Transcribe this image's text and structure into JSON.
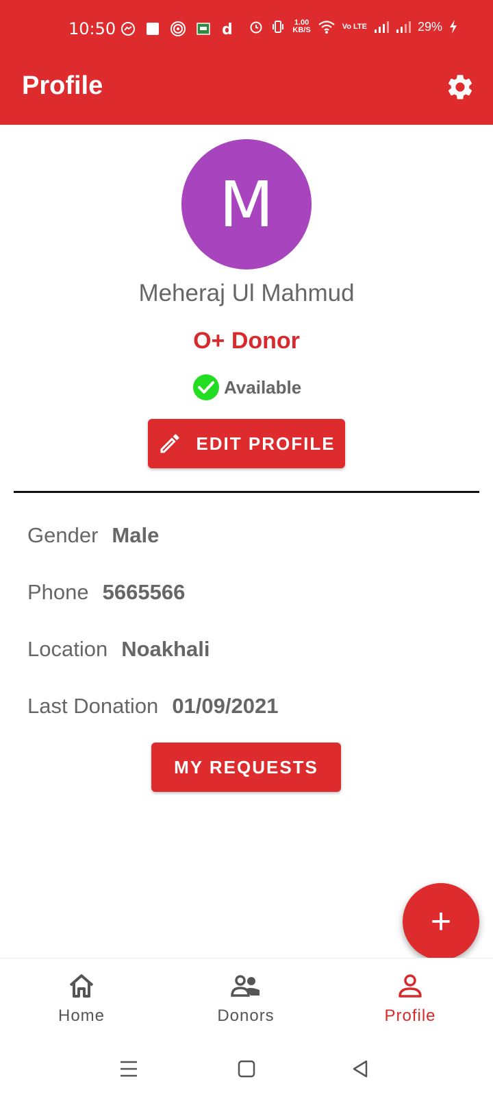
{
  "status_bar": {
    "time": "10:50",
    "speed_value": "1.00",
    "speed_unit": "KB/S",
    "volte": "Vo LTE",
    "battery": "29%"
  },
  "app_bar": {
    "title": "Profile",
    "settings_icon": "gear-icon",
    "color": "#DE2B2E"
  },
  "profile": {
    "avatar_letter": "M",
    "avatar_color": "#A844BE",
    "name": "Meheraj Ul Mahmud",
    "blood_group": "O+ Donor",
    "availability": "Available",
    "edit_button": "EDIT PROFILE"
  },
  "details": {
    "gender_label": "Gender",
    "gender_value": "Male",
    "phone_label": "Phone",
    "phone_value": "5665566",
    "location_label": "Location",
    "location_value": "Noakhali",
    "last_donation_label": "Last Donation",
    "last_donation_value": "01/09/2021"
  },
  "actions": {
    "my_requests": "MY REQUESTS",
    "fab_symbol": "+"
  },
  "bottom_nav": {
    "items": [
      {
        "label": "Home",
        "icon": "home-icon"
      },
      {
        "label": "Donors",
        "icon": "donors-icon"
      },
      {
        "label": "Profile",
        "icon": "profile-icon",
        "active": true
      }
    ]
  }
}
